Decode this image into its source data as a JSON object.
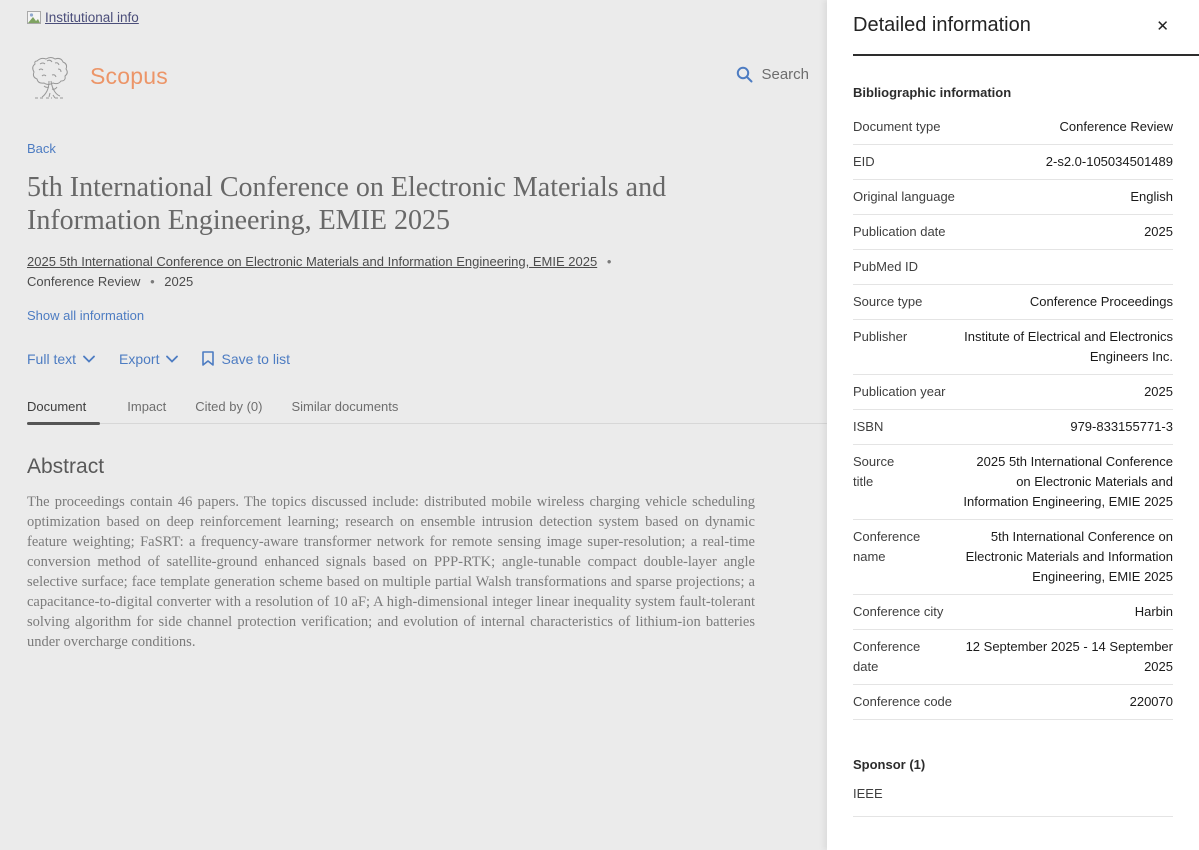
{
  "colors": {
    "page_background": "#ebebeb",
    "panel_background": "#ffffff",
    "link_blue": "#4d7cc2",
    "scopus_orange": "#ec9568",
    "institutional_link": "#4b4e7a",
    "dark_text": "#242424",
    "active_tab_underline": "#555555"
  },
  "header": {
    "institutional_link": "Institutional info",
    "logo_text": "Scopus",
    "search_label": "Search"
  },
  "nav": {
    "back_label": "Back"
  },
  "document": {
    "title": "5th International Conference on Electronic Materials and Information Engineering, EMIE 2025",
    "source_link": "2025 5th International Conference on Electronic Materials and Information Engineering, EMIE 2025",
    "meta_separator": "•",
    "doc_type": "Conference Review",
    "year": "2025",
    "show_all_label": "Show all information",
    "actions": {
      "full_text": "Full text",
      "export": "Export",
      "save_to_list": "Save to list"
    },
    "tabs": [
      {
        "label": "Document",
        "active": true
      },
      {
        "label": "Impact",
        "active": false
      },
      {
        "label": "Cited by (0)",
        "active": false
      },
      {
        "label": "Similar documents",
        "active": false
      }
    ],
    "abstract_heading": "Abstract",
    "abstract_text": "The proceedings contain 46 papers. The topics discussed include: distributed mobile wireless charging vehicle scheduling optimization based on deep reinforcement learning; research on ensemble intrusion detection system based on dynamic feature weighting; FaSRT: a frequency-aware transformer network for remote sensing image super-resolution; a real-time conversion method of satellite-ground enhanced signals based on PPP-RTK; angle-tunable compact double-layer angle selective surface; face template generation scheme based on multiple partial Walsh transformations and sparse projections; a capacitance-to-digital converter with a resolution of 10 aF; A high-dimensional integer linear inequality system fault-tolerant solving algorithm for side channel protection verification; and evolution of internal characteristics of lithium-ion batteries under overcharge conditions."
  },
  "panel": {
    "title": "Detailed information",
    "close_glyph": "✕",
    "section_bibliographic": "Bibliographic information",
    "rows": [
      {
        "label": "Document type",
        "value": "Conference Review"
      },
      {
        "label": "EID",
        "value": "2-s2.0-105034501489"
      },
      {
        "label": "Original language",
        "value": "English"
      },
      {
        "label": "Publication date",
        "value": "2025"
      },
      {
        "label": "PubMed ID",
        "value": ""
      },
      {
        "label": "Source type",
        "value": "Conference Proceedings"
      },
      {
        "label": "Publisher",
        "value": "Institute of Electrical and Electronics Engineers Inc."
      },
      {
        "label": "Publication year",
        "value": "2025"
      },
      {
        "label": "ISBN",
        "value": "979-833155771-3"
      },
      {
        "label": "Source\ntitle",
        "value": "2025 5th International Conference on Electronic Materials and Information Engineering, EMIE 2025"
      },
      {
        "label": "Conference\nname",
        "value": "5th International Conference on Electronic Materials and Information Engineering, EMIE 2025"
      },
      {
        "label": "Conference city",
        "value": "Harbin"
      },
      {
        "label": "Conference\ndate",
        "value": "12 September 2025 - 14 September 2025"
      },
      {
        "label": "Conference code",
        "value": "220070"
      }
    ],
    "section_sponsor": "Sponsor (1)",
    "sponsors": [
      "IEEE"
    ]
  },
  "icons": {
    "search": "magnifier",
    "close": "✕",
    "chevron_down": "∨",
    "bookmark": "save-ribbon",
    "broken_image": "broken-image",
    "tree_logo": "elsevier-tree"
  }
}
